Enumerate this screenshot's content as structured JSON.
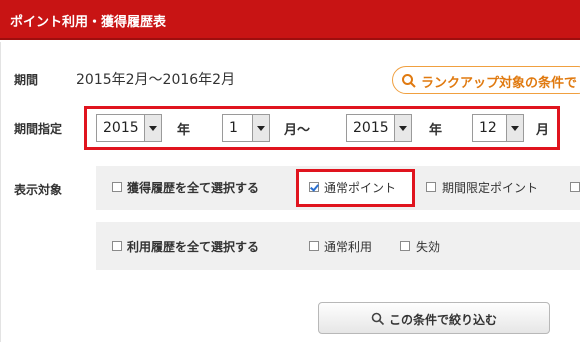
{
  "header": {
    "title": "ポイント利用・獲得履歴表"
  },
  "period": {
    "label": "期間",
    "value": "2015年2月～2016年2月"
  },
  "rank_button": {
    "label": "ランクアップ対象の条件で"
  },
  "period_spec": {
    "label": "期間指定",
    "from_year": "2015",
    "year_unit_1": "年",
    "from_month": "1",
    "month_unit_1": "月～",
    "to_year": "2015",
    "year_unit_2": "年",
    "to_month": "12",
    "month_unit_2": "月"
  },
  "display_target": {
    "label": "表示対象",
    "acquired_all": "獲得履歴を全て選択する",
    "normal_points": "通常ポイント",
    "limited_points": "期間限定ポイント",
    "usage_all": "利用履歴を全て選択する",
    "normal_usage": "通常利用",
    "expired": "失効"
  },
  "filter_button": {
    "label": "この条件で絞り込む"
  },
  "colors": {
    "header": "#c81414",
    "highlight": "#e0141e",
    "accent": "#e07a10"
  }
}
